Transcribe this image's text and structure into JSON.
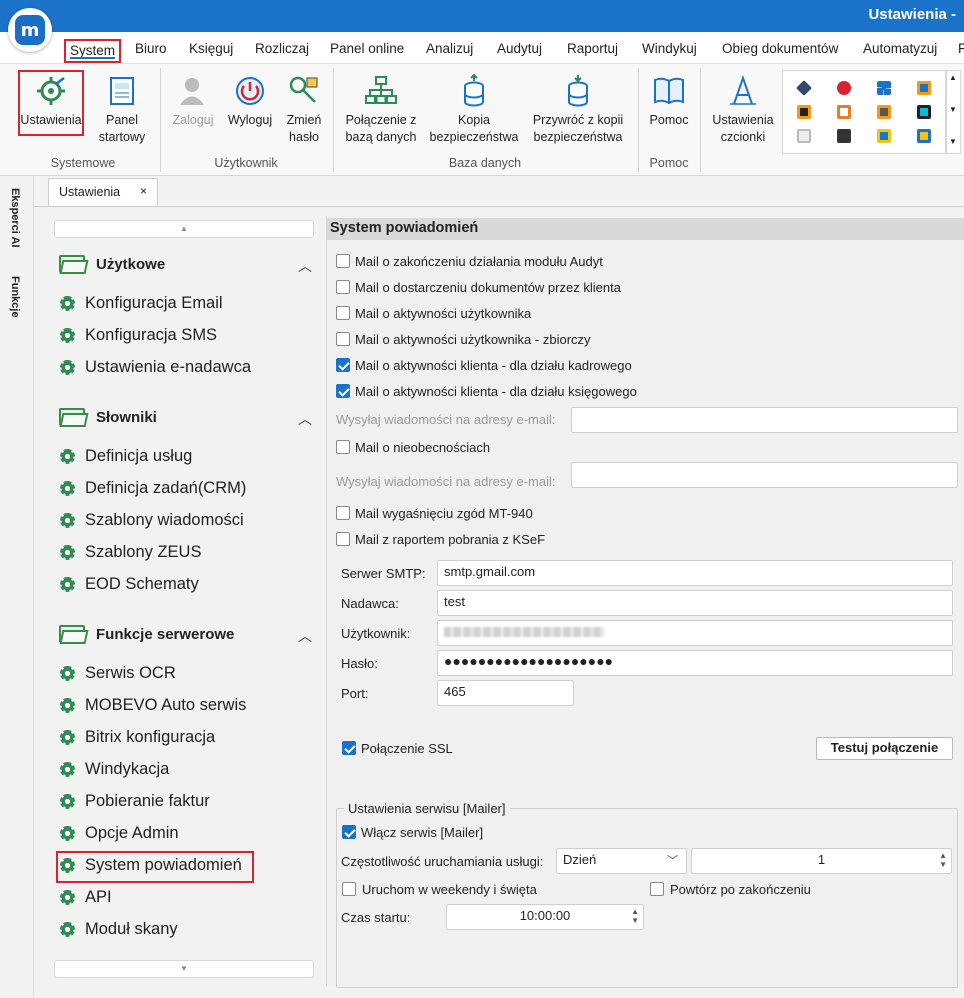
{
  "window": {
    "title": "Ustawienia -"
  },
  "logo": {
    "letter": "m"
  },
  "menu": [
    "System",
    "Biuro",
    "Księguj",
    "Rozliczaj",
    "Panel online",
    "Analizuj",
    "Audytuj",
    "Raportuj",
    "Windykuj",
    "Obieg dokumentów",
    "Automatyzuj",
    "F"
  ],
  "ribbon": {
    "buttons": {
      "ustawienia": "Ustawienia",
      "panel": "Panel startowy",
      "zaloguj": "Zaloguj",
      "wyloguj": "Wyloguj",
      "zmien": "Zmień hasło",
      "polaczenie": "Połączenie z bazą danych",
      "kopia": "Kopia bezpieczeństwa",
      "przywroc": "Przywróć z kopii bezpieczeństwa",
      "pomoc": "Pomoc",
      "czcionki": "Ustawienia czcionki"
    },
    "groups": {
      "systemowe": "Systemowe",
      "uzytkownik": "Użytkownik",
      "baza": "Baza danych",
      "pomoc": "Pomoc"
    }
  },
  "sidebar": {
    "ai": "Eksperci AI",
    "funkcje": "Funkcje"
  },
  "tab": {
    "label": "Ustawienia",
    "close": "×"
  },
  "nav": {
    "groups": [
      {
        "title": "Użytkowe",
        "items": [
          "Konfiguracja Email",
          "Konfiguracja SMS",
          "Ustawienia e-nadawca"
        ]
      },
      {
        "title": "Słowniki",
        "items": [
          "Definicja usług",
          "Definicja zadań(CRM)",
          "Szablony wiadomości",
          "Szablony ZEUS",
          "EOD Schematy"
        ]
      },
      {
        "title": "Funkcje serwerowe",
        "items": [
          "Serwis OCR",
          "MOBEVO Auto serwis",
          "Bitrix konfiguracja",
          "Windykacja",
          "Pobieranie faktur",
          "Opcje Admin",
          "System powiadomień",
          "API",
          "Moduł skany"
        ]
      }
    ],
    "selected": "System powiadomień"
  },
  "panel": {
    "title": "System powiadomień",
    "checkboxes": [
      {
        "label": "Mail o zakończeniu działania modułu Audyt",
        "checked": false
      },
      {
        "label": "Mail o dostarczeniu dokumentów przez klienta",
        "checked": false
      },
      {
        "label": "Mail o aktywności użytkownika",
        "checked": false
      },
      {
        "label": "Mail o aktywności użytkownika - zbiorczy",
        "checked": false
      },
      {
        "label": "Mail o aktywności klienta - dla działu kadrowego",
        "checked": true
      },
      {
        "label": "Mail o aktywności klienta - dla działu księgowego",
        "checked": true
      }
    ],
    "email_label1": "Wysyłaj wiadomości na adresy e-mail:",
    "email_value1": "",
    "nieob": {
      "label": "Mail o nieobecnościach",
      "checked": false
    },
    "email_label2": "Wysyłaj wiadomości na adresy e-mail:",
    "email_value2": "",
    "mt940": {
      "label": "Mail wygaśnięciu zgód MT-940",
      "checked": false
    },
    "ksef": {
      "label": "Mail z raportem pobrania z KSeF",
      "checked": false
    },
    "smtp": {
      "server_label": "Serwer SMTP:",
      "server": "smtp.gmail.com",
      "sender_label": "Nadawca:",
      "sender": "test",
      "user_label": "Użytkownik:",
      "user": "",
      "pass_label": "Hasło:",
      "pass": "●●●●●●●●●●●●●●●●●●●●",
      "port_label": "Port:",
      "port": "465"
    },
    "ssl": {
      "label": "Połączenie SSL",
      "checked": true
    },
    "test_button": "Testuj połączenie",
    "service": {
      "title": "Ustawienia serwisu [Mailer]",
      "enable": {
        "label": "Włącz serwis [Mailer]",
        "checked": true
      },
      "freq_label": "Częstotliwość uruchamiania usługi:",
      "freq_unit": "Dzień",
      "freq_value": "1",
      "weekend": {
        "label": "Uruchom w weekendy i święta",
        "checked": false
      },
      "repeat": {
        "label": "Powtórz po zakończeniu",
        "checked": false
      },
      "start_label": "Czas startu:",
      "start_value": "10:00:00"
    }
  }
}
